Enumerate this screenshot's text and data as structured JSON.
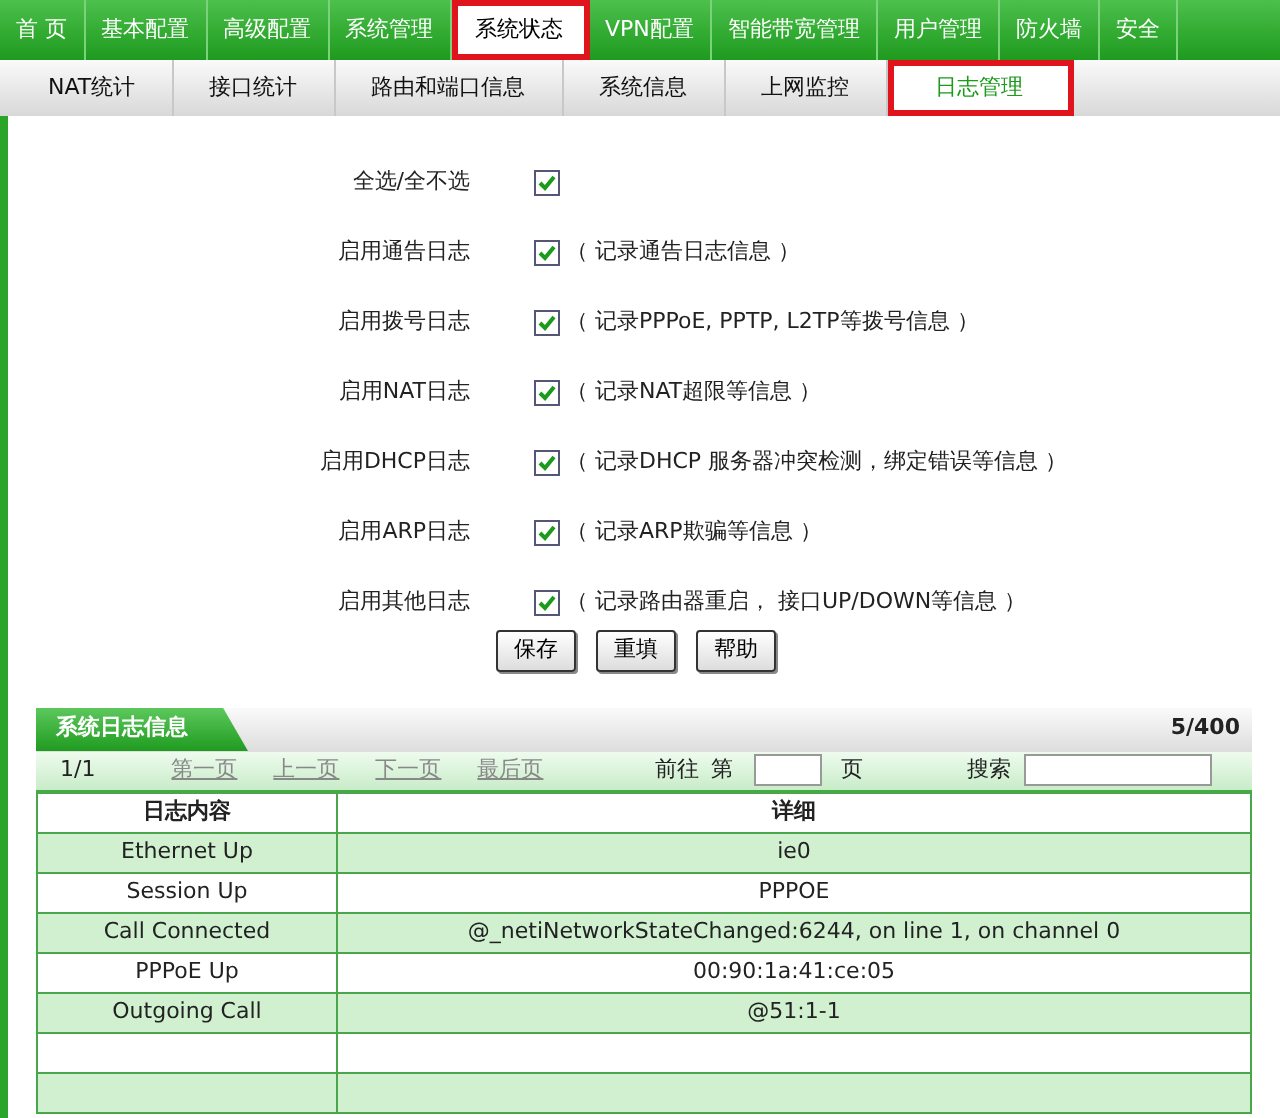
{
  "top_nav": [
    {
      "label": "首 页",
      "selected": false
    },
    {
      "label": "基本配置",
      "selected": false
    },
    {
      "label": "高级配置",
      "selected": false
    },
    {
      "label": "系统管理",
      "selected": false
    },
    {
      "label": "系统状态",
      "selected": true
    },
    {
      "label": "VPN配置",
      "selected": false
    },
    {
      "label": "智能带宽管理",
      "selected": false
    },
    {
      "label": "用户管理",
      "selected": false
    },
    {
      "label": "防火墙",
      "selected": false
    },
    {
      "label": "安全",
      "selected": false
    }
  ],
  "sub_nav": [
    {
      "label": "NAT统计",
      "selected": false
    },
    {
      "label": "接口统计",
      "selected": false
    },
    {
      "label": "路由和端口信息",
      "selected": false
    },
    {
      "label": "系统信息",
      "selected": false
    },
    {
      "label": "上网监控",
      "selected": false
    },
    {
      "label": "日志管理",
      "selected": true
    }
  ],
  "log_options": [
    {
      "label": "全选/全不选",
      "checked": true
    },
    {
      "label": "启用通告日志",
      "checked": true,
      "note": "（ 记录通告日志信息 ）"
    },
    {
      "label": "启用拨号日志",
      "checked": true,
      "note": "（ 记录PPPoE, PPTP, L2TP等拨号信息 ）"
    },
    {
      "label": "启用NAT日志",
      "checked": true,
      "note": "（ 记录NAT超限等信息 ）"
    },
    {
      "label": "启用DHCP日志",
      "checked": true,
      "note": "（ 记录DHCP 服务器冲突检测，绑定错误等信息 ）"
    },
    {
      "label": "启用ARP日志",
      "checked": true,
      "note": "（ 记录ARP欺骗等信息 ）"
    },
    {
      "label": "启用其他日志",
      "checked": true,
      "note": "（ 记录路由器重启， 接口UP/DOWN等信息 ）"
    }
  ],
  "buttons": [
    "保存",
    "重填",
    "帮助"
  ],
  "log_panel": {
    "title": "系统日志信息",
    "count": "5/400",
    "pager": {
      "page": "1/1",
      "links": [
        "第一页",
        "上一页",
        "下一页",
        "最后页"
      ],
      "goto_label": "前往",
      "page_prefix": "第",
      "page_suffix": "页",
      "search_label": "搜索"
    },
    "table": {
      "columns": [
        "日志内容",
        "详细"
      ],
      "rows": [
        [
          "Ethernet Up",
          "ie0"
        ],
        [
          "Session Up",
          "PPPOE"
        ],
        [
          "Call Connected",
          "@_netiNetworkStateChanged:6244, on line 1, on channel 0"
        ],
        [
          "PPPoE Up",
          "00:90:1a:41:ce:05"
        ],
        [
          "Outgoing Call",
          "@51:1-1"
        ]
      ]
    }
  }
}
